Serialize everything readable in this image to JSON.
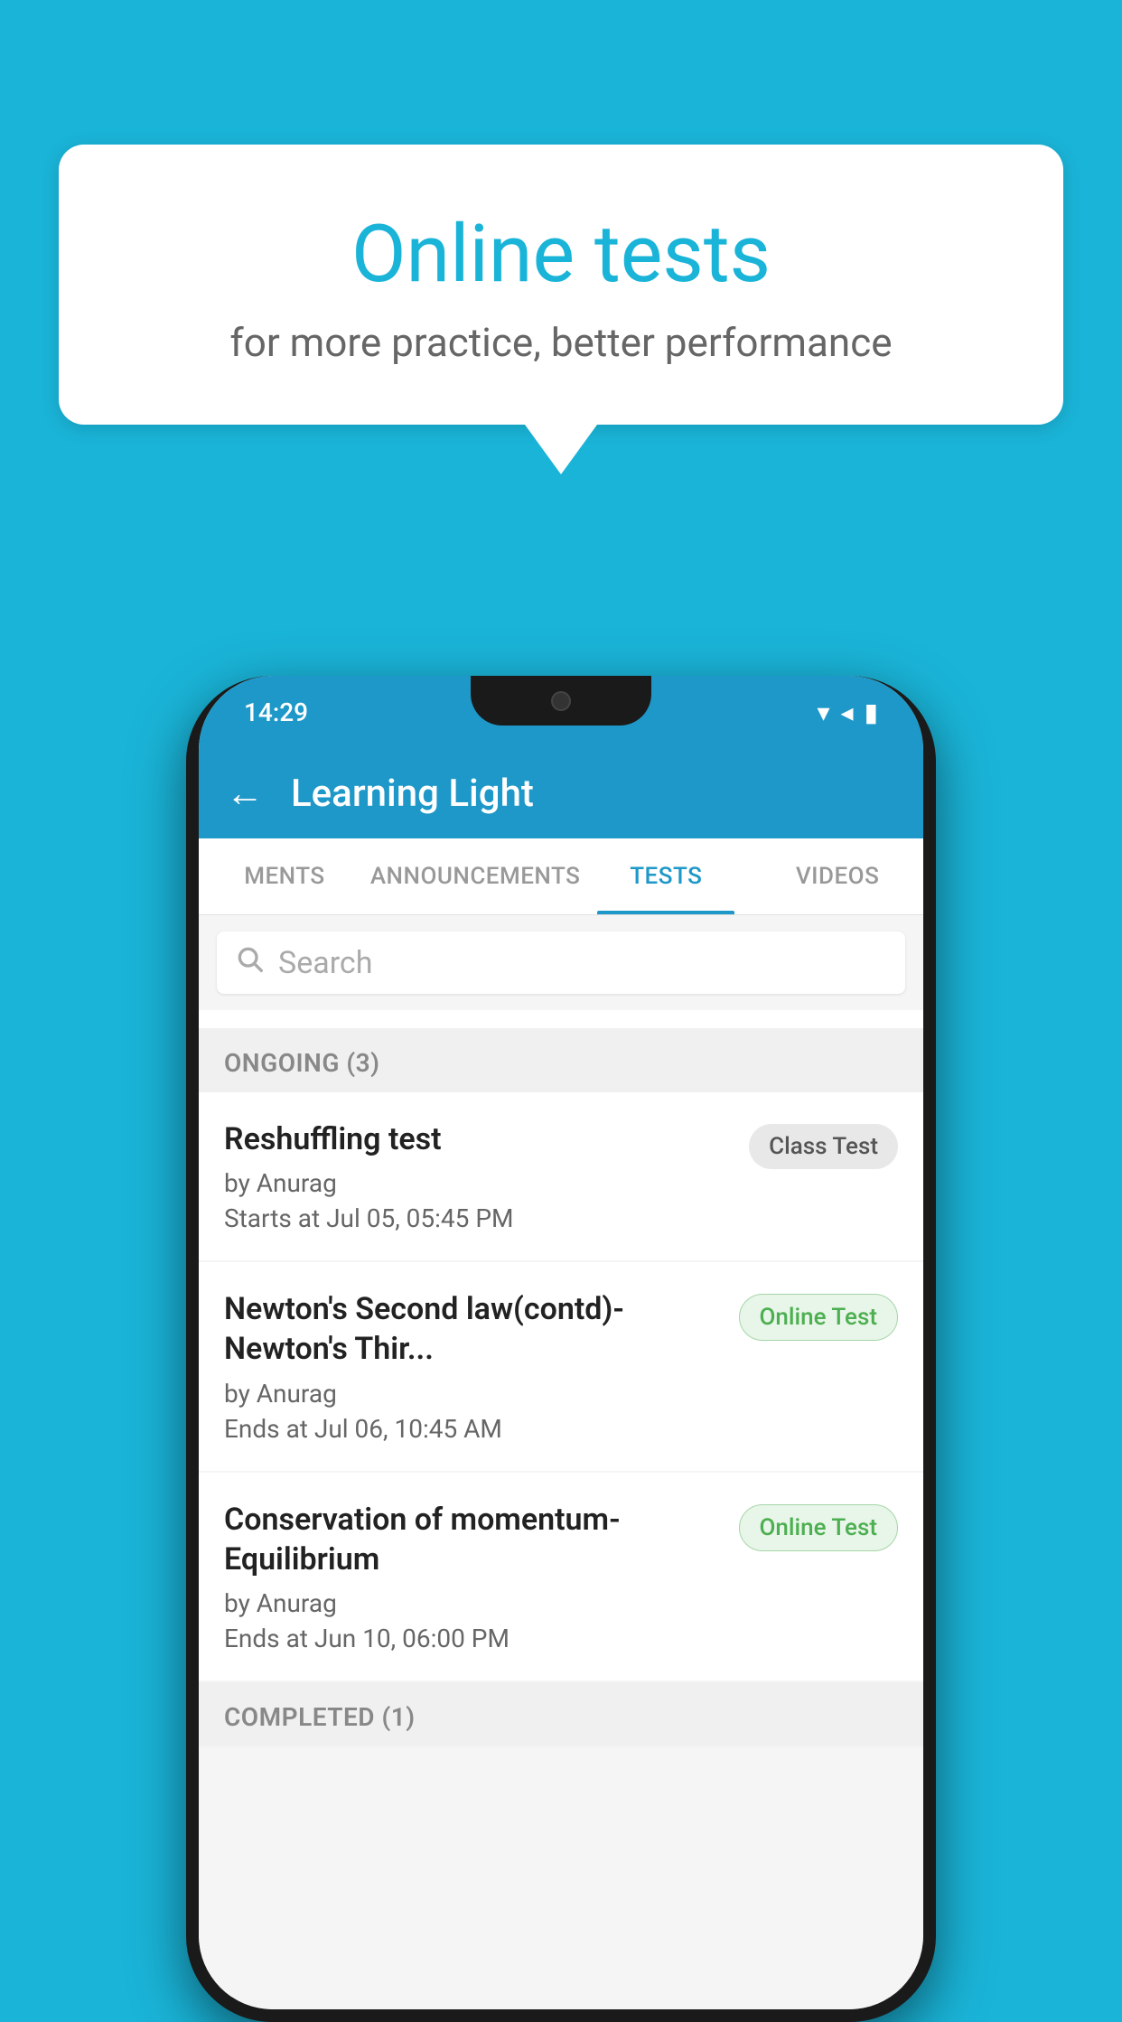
{
  "background_color": "#1ab4d8",
  "promo": {
    "title": "Online tests",
    "subtitle": "for more practice, better performance"
  },
  "phone": {
    "status_bar": {
      "time": "14:29"
    },
    "app_bar": {
      "title": "Learning Light",
      "back_label": "←"
    },
    "tabs": [
      {
        "label": "MENTS",
        "active": false
      },
      {
        "label": "ANNOUNCEMENTS",
        "active": false
      },
      {
        "label": "TESTS",
        "active": true
      },
      {
        "label": "VIDEOS",
        "active": false
      }
    ],
    "search": {
      "placeholder": "Search"
    },
    "sections": [
      {
        "title": "ONGOING (3)",
        "tests": [
          {
            "name": "Reshuffling test",
            "author": "by Anurag",
            "date": "Starts at  Jul 05, 05:45 PM",
            "badge": "Class Test",
            "badge_type": "class"
          },
          {
            "name": "Newton's Second law(contd)-Newton's Thir...",
            "author": "by Anurag",
            "date": "Ends at  Jul 06, 10:45 AM",
            "badge": "Online Test",
            "badge_type": "online"
          },
          {
            "name": "Conservation of momentum-Equilibrium",
            "author": "by Anurag",
            "date": "Ends at  Jun 10, 06:00 PM",
            "badge": "Online Test",
            "badge_type": "online"
          }
        ]
      },
      {
        "title": "COMPLETED (1)",
        "tests": []
      }
    ]
  }
}
